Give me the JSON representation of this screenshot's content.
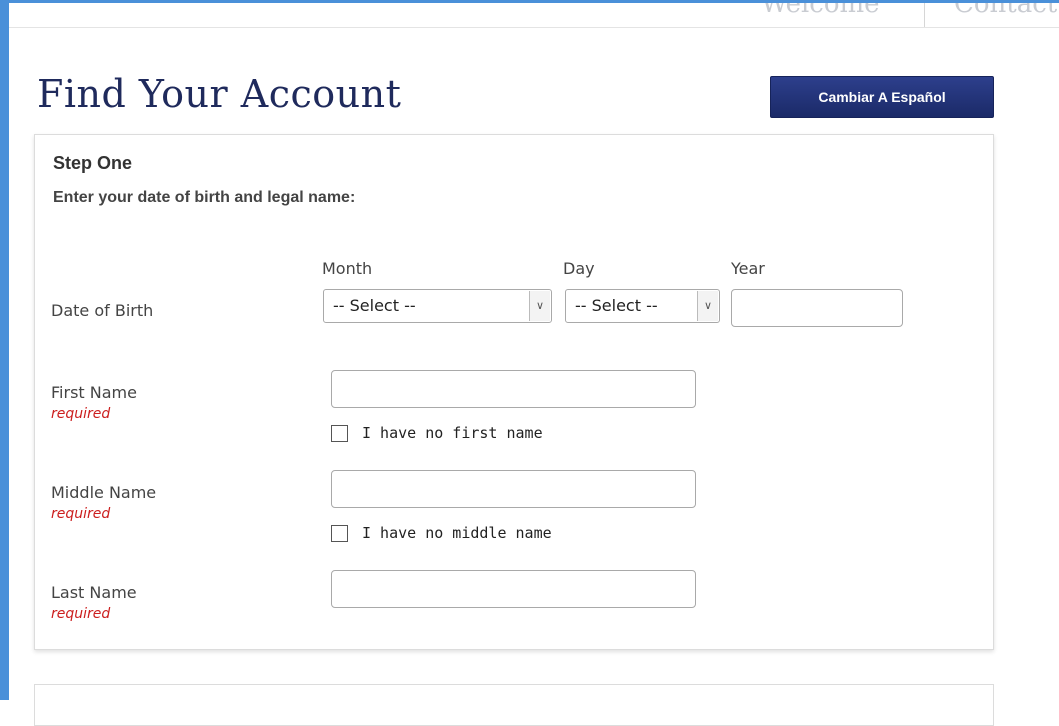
{
  "nav": {
    "items": [
      "Welcome",
      "Contact"
    ]
  },
  "header": {
    "title": "Find Your Account",
    "language_button": "Cambiar A Español"
  },
  "step": {
    "title": "Step One",
    "subtitle": "Enter your date of birth and legal name:"
  },
  "dob": {
    "label": "Date of Birth",
    "month_label": "Month",
    "day_label": "Day",
    "year_label": "Year",
    "month_value": "-- Select --",
    "day_value": "-- Select --",
    "year_value": ""
  },
  "first_name": {
    "label": "First Name",
    "required": "required",
    "value": "",
    "no_name_label": "I have no first name",
    "no_name_checked": false
  },
  "middle_name": {
    "label": "Middle Name",
    "required": "required",
    "value": "",
    "no_name_label": "I have no middle name",
    "no_name_checked": false
  },
  "last_name": {
    "label": "Last Name",
    "required": "required",
    "value": ""
  }
}
